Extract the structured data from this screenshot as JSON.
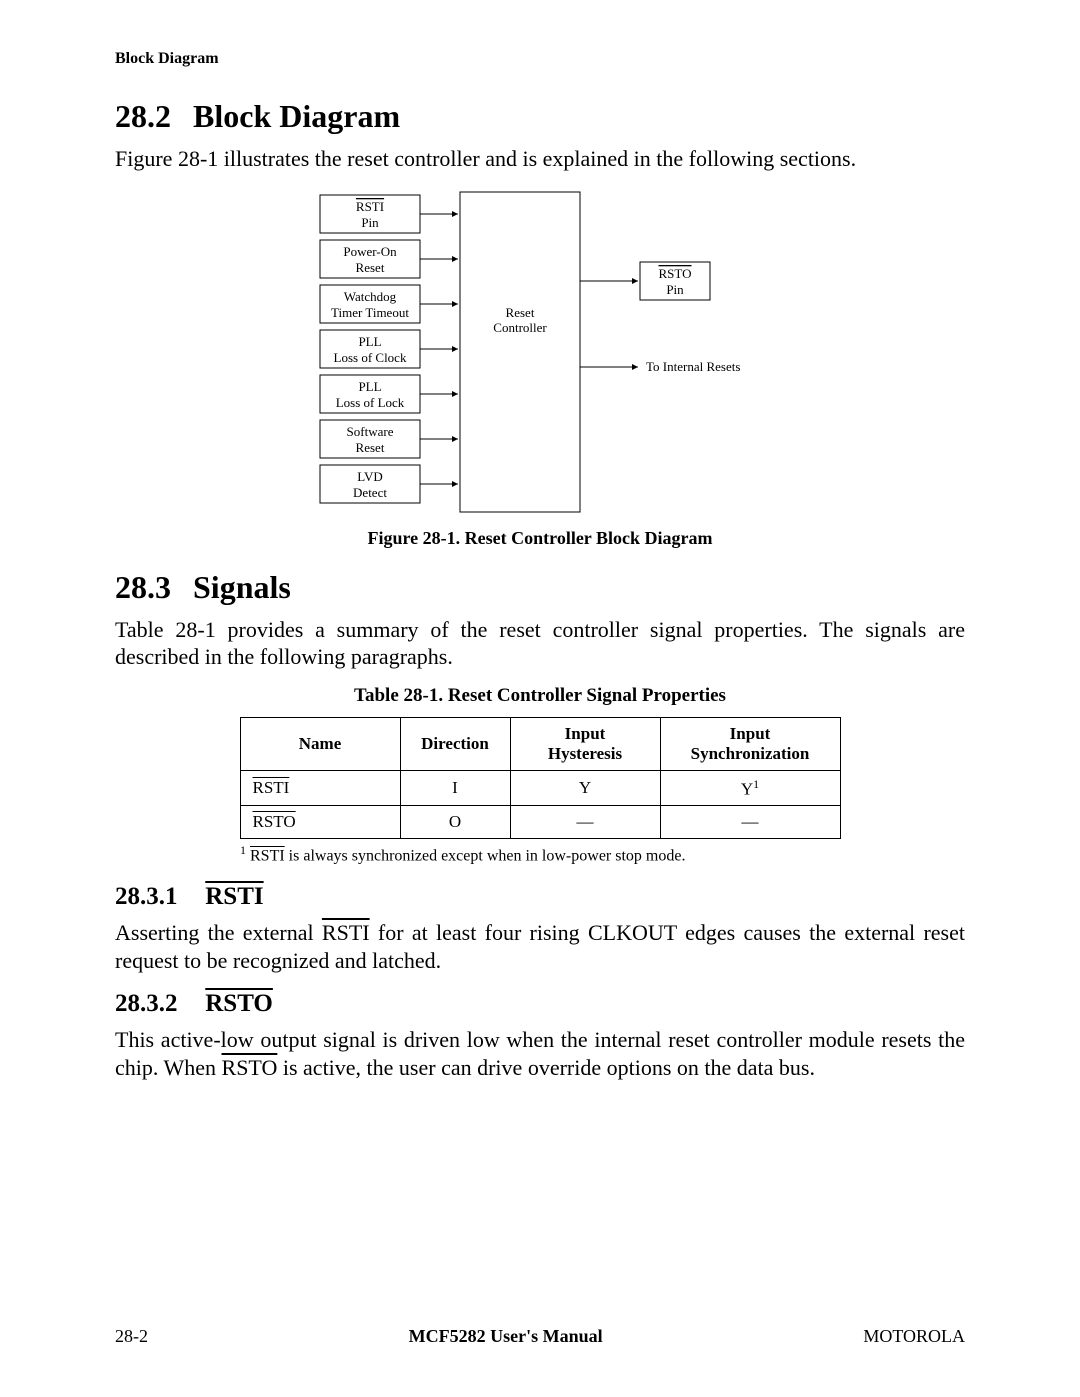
{
  "running_head": "Block Diagram",
  "section_282": {
    "num": "28.2",
    "title": "Block Diagram"
  },
  "intro_282": "Figure 28-1 illustrates the reset controller and is explained in the following sections.",
  "diagram": {
    "inputs": [
      {
        "line1": "RSTI",
        "line2": "Pin",
        "overbar": true
      },
      {
        "line1": "Power-On",
        "line2": "Reset",
        "overbar": false
      },
      {
        "line1": "Watchdog",
        "line2": "Timer Timeout",
        "overbar": false
      },
      {
        "line1": "PLL",
        "line2": "Loss of Clock",
        "overbar": false
      },
      {
        "line1": "PLL",
        "line2": "Loss of Lock",
        "overbar": false
      },
      {
        "line1": "Software",
        "line2": "Reset",
        "overbar": false
      },
      {
        "line1": "LVD",
        "line2": "Detect",
        "overbar": false
      }
    ],
    "core": {
      "line1": "Reset",
      "line2": "Controller"
    },
    "outputs": [
      {
        "line1": "RSTO",
        "line2": "Pin",
        "overbar": true
      },
      {
        "label": "To Internal Resets"
      }
    ]
  },
  "fig_caption": "Figure 28-1. Reset Controller Block Diagram",
  "section_283": {
    "num": "28.3",
    "title": "Signals"
  },
  "intro_283": "Table 28-1 provides a summary of the reset controller signal properties. The signals are described in the following paragraphs.",
  "table_caption": "Table 28-1.  Reset Controller Signal Properties",
  "table": {
    "headers": [
      "Name",
      "Direction",
      "Input\nHysteresis",
      "Input\nSynchronization"
    ],
    "rows": [
      {
        "name": "RSTI",
        "overbar": true,
        "direction": "I",
        "hysteresis": "Y",
        "sync": "Y",
        "sync_sup": "1"
      },
      {
        "name": "RSTO",
        "overbar": true,
        "direction": "O",
        "hysteresis": "—",
        "sync": "—",
        "sync_sup": ""
      }
    ]
  },
  "footnote": {
    "sup": "1",
    "pre": "  ",
    "sig": "RSTI",
    "text": " is always synchronized except when in low-power stop mode."
  },
  "sub_2831": {
    "num": "28.3.1",
    "title": "RSTI"
  },
  "body_2831_a": "Asserting the external ",
  "body_2831_sig": "RSTI",
  "body_2831_b": " for at least four rising CLKOUT edges causes the external reset request to be recognized and latched.",
  "sub_2832": {
    "num": "28.3.2",
    "title": "RSTO"
  },
  "body_2832_a": "This active-low output signal is driven low when the internal reset controller module resets the chip. When ",
  "body_2832_sig": "RSTO",
  "body_2832_b": " is active, the user can drive override options on the data bus.",
  "footer": {
    "left": "28-2",
    "center": "MCF5282 User's Manual",
    "right": "MOTOROLA"
  },
  "col_widths": {
    "name": 160,
    "direction": 110,
    "hyst": 150,
    "sync": 180
  }
}
